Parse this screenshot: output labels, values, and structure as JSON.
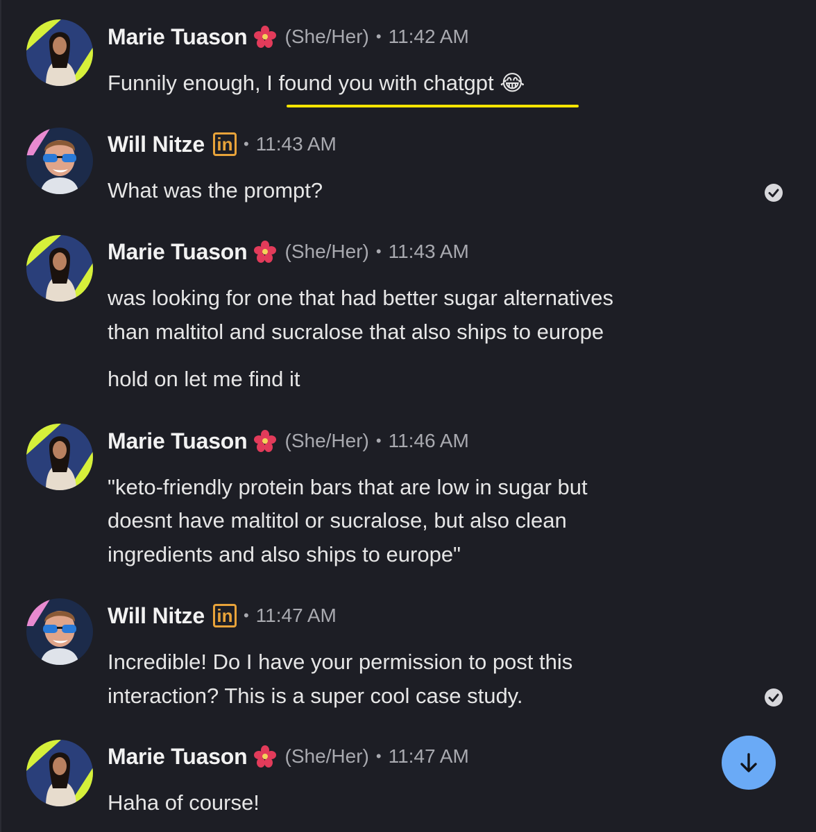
{
  "messages": [
    {
      "author": "Marie Tuason",
      "pronouns": "(She/Her)",
      "time": "11:42 AM",
      "lines": [
        "Funnily enough, I found you with chatgpt 😂"
      ],
      "highlight": "I found you with chatgpt 😂"
    },
    {
      "author": "Will Nitze",
      "badge": "in",
      "time": "11:43 AM",
      "lines": [
        "What was the prompt?"
      ],
      "status": "read"
    },
    {
      "author": "Marie Tuason",
      "pronouns": "(She/Her)",
      "time": "11:43 AM",
      "lines": [
        "was looking for one that had better sugar alternatives",
        "than maltitol and sucralose that also ships to europe"
      ],
      "extra_line": "hold on let me find it"
    },
    {
      "author": "Marie Tuason",
      "pronouns": "(She/Her)",
      "time": "11:46 AM",
      "lines": [
        "\"keto-friendly protein bars that are low in sugar but",
        "doesnt have maltitol or sucralose, but also clean",
        "ingredients and also ships to europe\""
      ]
    },
    {
      "author": "Will Nitze",
      "badge": "in",
      "time": "11:47 AM",
      "lines": [
        "Incredible! Do I have your permission to post this",
        "interaction? This is a super cool case study."
      ],
      "status": "read"
    },
    {
      "author": "Marie Tuason",
      "pronouns": "(She/Her)",
      "time": "11:47 AM",
      "lines": [
        "Haha of course!"
      ]
    }
  ],
  "separator": "•",
  "icons": {
    "flower": "hibiscus-icon",
    "badge": "linkedin-icon",
    "read": "read-receipt-icon",
    "scroll": "arrow-down-icon"
  },
  "colors": {
    "background": "#1d1e25",
    "highlight_underline": "#f5e400",
    "linkedin_badge": "#e8a33a",
    "scroll_button": "#6aaaf6"
  }
}
